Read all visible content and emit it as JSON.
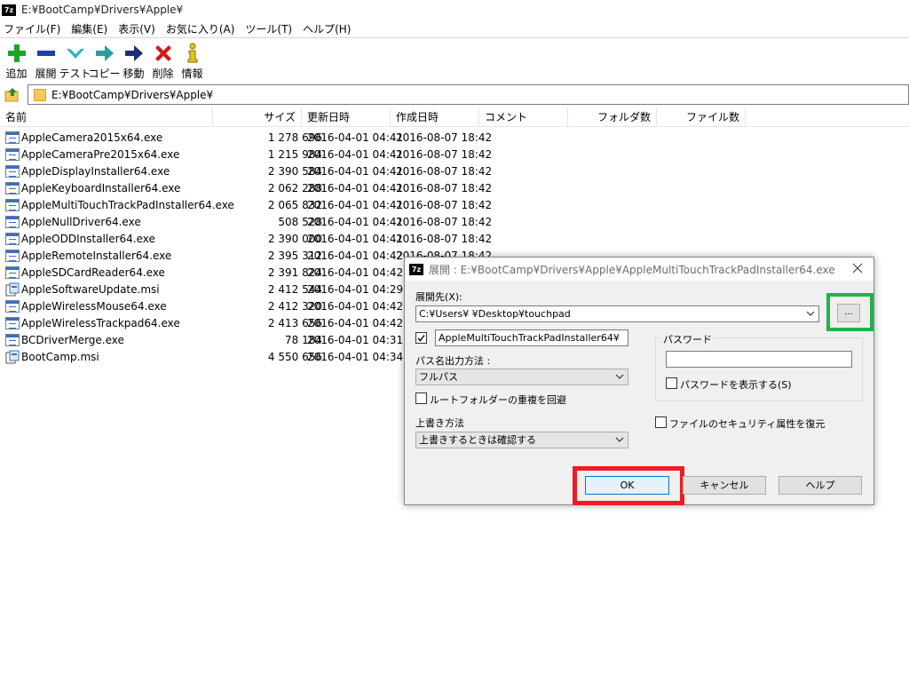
{
  "window": {
    "app_icon": "7z",
    "title": "E:¥BootCamp¥Drivers¥Apple¥"
  },
  "menu": [
    "ファイル(F)",
    "編集(E)",
    "表示(V)",
    "お気に入り(A)",
    "ツール(T)",
    "ヘルプ(H)"
  ],
  "toolbar": [
    {
      "icon": "plus-icon",
      "label": "追加",
      "color": "#1fa32a"
    },
    {
      "icon": "minus-icon",
      "label": "展開",
      "color": "#1d3fa8"
    },
    {
      "icon": "check-icon",
      "label": "テスト",
      "color": "#2bb5bd"
    },
    {
      "icon": "copy-arrow-icon",
      "label": "コピー",
      "color": "#2b9c9a"
    },
    {
      "icon": "move-arrow-icon",
      "label": "移動",
      "color": "#1f2d7b"
    },
    {
      "icon": "delete-x-icon",
      "label": "削除",
      "color": "#d11a1a"
    },
    {
      "icon": "info-icon",
      "label": "情報",
      "color": "#e6c51a"
    }
  ],
  "address": "E:¥BootCamp¥Drivers¥Apple¥",
  "columns": {
    "name": "名前",
    "size": "サイズ",
    "modified": "更新日時",
    "created": "作成日時",
    "comment": "コメント",
    "folders": "フォルダ数",
    "files": "ファイル数"
  },
  "files": [
    {
      "name": "AppleCamera2015x64.exe",
      "size": "1 278 696",
      "modified": "2016-04-01 04:41",
      "created": "2016-08-07 18:42",
      "type": "exe"
    },
    {
      "name": "AppleCameraPre2015x64.exe",
      "size": "1 215 984",
      "modified": "2016-04-01 04:41",
      "created": "2016-08-07 18:42",
      "type": "exe"
    },
    {
      "name": "AppleDisplayInstaller64.exe",
      "size": "2 390 584",
      "modified": "2016-04-01 04:41",
      "created": "2016-08-07 18:42",
      "type": "exe"
    },
    {
      "name": "AppleKeyboardInstaller64.exe",
      "size": "2 062 288",
      "modified": "2016-04-01 04:41",
      "created": "2016-08-07 18:42",
      "type": "exe"
    },
    {
      "name": "AppleMultiTouchTrackPadInstaller64.exe",
      "size": "2 065 832",
      "modified": "2016-04-01 04:41",
      "created": "2016-08-07 18:42",
      "type": "exe"
    },
    {
      "name": "AppleNullDriver64.exe",
      "size": "508 528",
      "modified": "2016-04-01 04:41",
      "created": "2016-08-07 18:42",
      "type": "exe"
    },
    {
      "name": "AppleODDInstaller64.exe",
      "size": "2 390 000",
      "modified": "2016-04-01 04:41",
      "created": "2016-08-07 18:42",
      "type": "exe"
    },
    {
      "name": "AppleRemoteInstaller64.exe",
      "size": "2 395 312",
      "modified": "2016-04-01 04:42",
      "created": "2016-08-07 18:42",
      "type": "exe"
    },
    {
      "name": "AppleSDCardReader64.exe",
      "size": "2 391 824",
      "modified": "2016-04-01 04:42",
      "created": "",
      "type": "exe"
    },
    {
      "name": "AppleSoftwareUpdate.msi",
      "size": "2 412 544",
      "modified": "2016-04-01 04:29",
      "created": "",
      "type": "msi"
    },
    {
      "name": "AppleWirelessMouse64.exe",
      "size": "2 412 320",
      "modified": "2016-04-01 04:42",
      "created": "",
      "type": "exe"
    },
    {
      "name": "AppleWirelessTrackpad64.exe",
      "size": "2 413 656",
      "modified": "2016-04-01 04:42",
      "created": "",
      "type": "exe"
    },
    {
      "name": "BCDriverMerge.exe",
      "size": "78 184",
      "modified": "2016-04-01 04:31",
      "created": "",
      "type": "exe"
    },
    {
      "name": "BootCamp.msi",
      "size": "4 550 656",
      "modified": "2016-04-01 04:34",
      "created": "",
      "type": "msi"
    }
  ],
  "dialog": {
    "title": "展開 : E:¥BootCamp¥Drivers¥Apple¥AppleMultiTouchTrackPadInstaller64.exe",
    "dest_label": "展開先(X):",
    "dest_value": "C:¥Users¥         ¥Desktop¥touchpad",
    "browse_label": "...",
    "subfolder_checked": true,
    "subfolder_value": "AppleMultiTouchTrackPadInstaller64¥",
    "path_mode_label": "パス名出力方法 :",
    "path_mode_value": "フルパス",
    "avoid_dup_label": "ルートフォルダーの重複を回避",
    "avoid_dup_checked": false,
    "overwrite_label": "上書き方法",
    "overwrite_value": "上書きするときは確認する",
    "password_group": "パスワード",
    "password_value": "",
    "show_password_label": "パスワードを表示する(S)",
    "show_password_checked": false,
    "restore_security_label": "ファイルのセキュリティ属性を復元",
    "restore_security_checked": false,
    "ok_label": "OK",
    "cancel_label": "キャンセル",
    "help_label": "ヘルプ"
  },
  "highlights": {
    "browse_color": "#22b14c",
    "ok_color": "#ed1c24"
  }
}
